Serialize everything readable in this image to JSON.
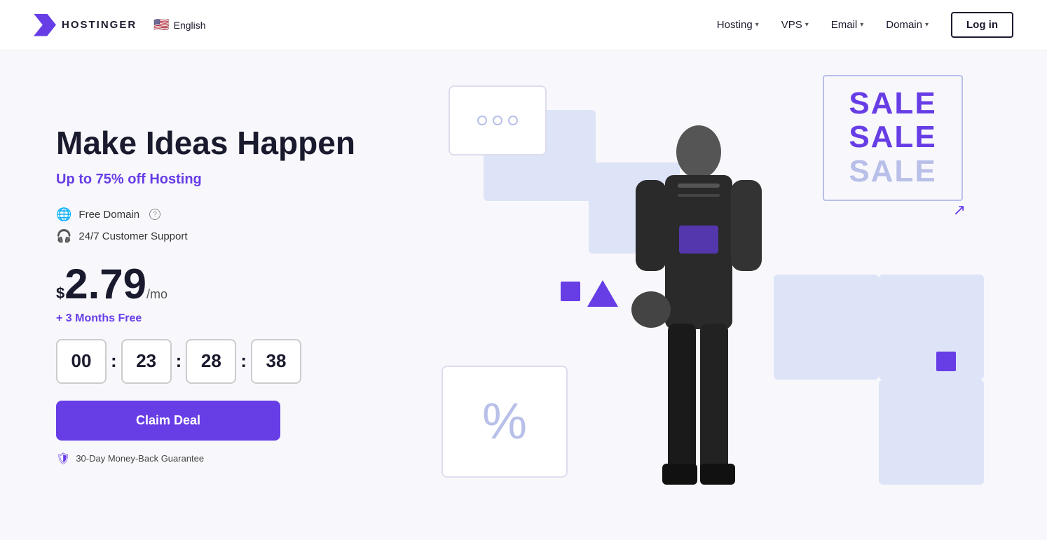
{
  "logo": {
    "text": "HOSTINGER"
  },
  "lang": {
    "flag": "🇺🇸",
    "label": "English"
  },
  "nav": {
    "items": [
      {
        "label": "Hosting",
        "id": "hosting"
      },
      {
        "label": "VPS",
        "id": "vps"
      },
      {
        "label": "Email",
        "id": "email"
      },
      {
        "label": "Domain",
        "id": "domain"
      }
    ],
    "login_label": "Log in"
  },
  "hero": {
    "headline": "Make Ideas Happen",
    "subheadline_prefix": "Up to ",
    "subheadline_highlight": "75%",
    "subheadline_suffix": " off Hosting",
    "features": [
      {
        "label": "Free Domain",
        "has_question": true
      },
      {
        "label": "24/7 Customer Support",
        "has_question": false
      }
    ],
    "price_currency": "$",
    "price_main": "2.79",
    "price_suffix": "/mo",
    "months_free": "+ 3 Months Free",
    "timer": {
      "hours": "00",
      "minutes": "23",
      "seconds": "28",
      "centiseconds": "38"
    },
    "cta_label": "Claim Deal",
    "guarantee": "30-Day Money-Back Guarantee"
  },
  "sale_box": {
    "line1": "SALE",
    "line2": "SALE",
    "line3": "SALE"
  }
}
